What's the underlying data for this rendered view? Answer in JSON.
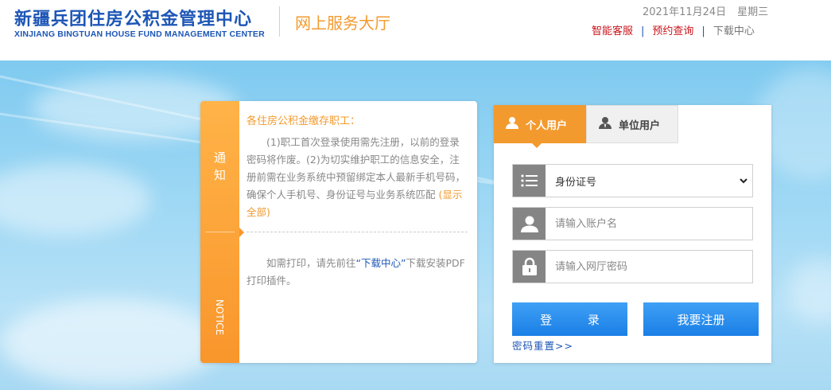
{
  "header": {
    "logo_cn": "新疆兵团住房公积金管理中心",
    "logo_en": "XINJIANG BINGTUAN HOUSE FUND MANAGEMENT CENTER",
    "hall_title": "网上服务大厅",
    "date": "2021年11月24日",
    "weekday": "星期三",
    "links": [
      "智能客服",
      "预约查询",
      "下载中心"
    ],
    "link_color": "#c8161d",
    "brand_color": "#1d56b6",
    "accent_color": "#f39a2e"
  },
  "notice": {
    "side_label": "通知",
    "side_label_en": "NOTICE",
    "title": "各住房公积金缴存职工：",
    "paragraph1": "(1)职工首次登录使用需先注册，以前的登录密码将作废。(2)为切实维护职工的信息安全，注册前需在业务系统中预留绑定本人最新手机号码，确保个人手机号、身份证号与业务系统匹配",
    "show_all": "(显示全部)",
    "paragraph2_before": "如需打印，请先前往",
    "paragraph2_link": "“下载中心”",
    "paragraph2_after": "下载安装PDF打印插件。"
  },
  "login": {
    "tabs": [
      {
        "label": "个人用户",
        "icon": "person-icon",
        "active": true
      },
      {
        "label": "单位用户",
        "icon": "business-person-icon",
        "active": false
      }
    ],
    "id_type_selected": "身份证号",
    "username_placeholder": "请输入账户名",
    "password_placeholder": "请输入网厅密码",
    "login_button": "登 录",
    "register_button": "我要注册",
    "reset_link": "密码重置>>"
  }
}
